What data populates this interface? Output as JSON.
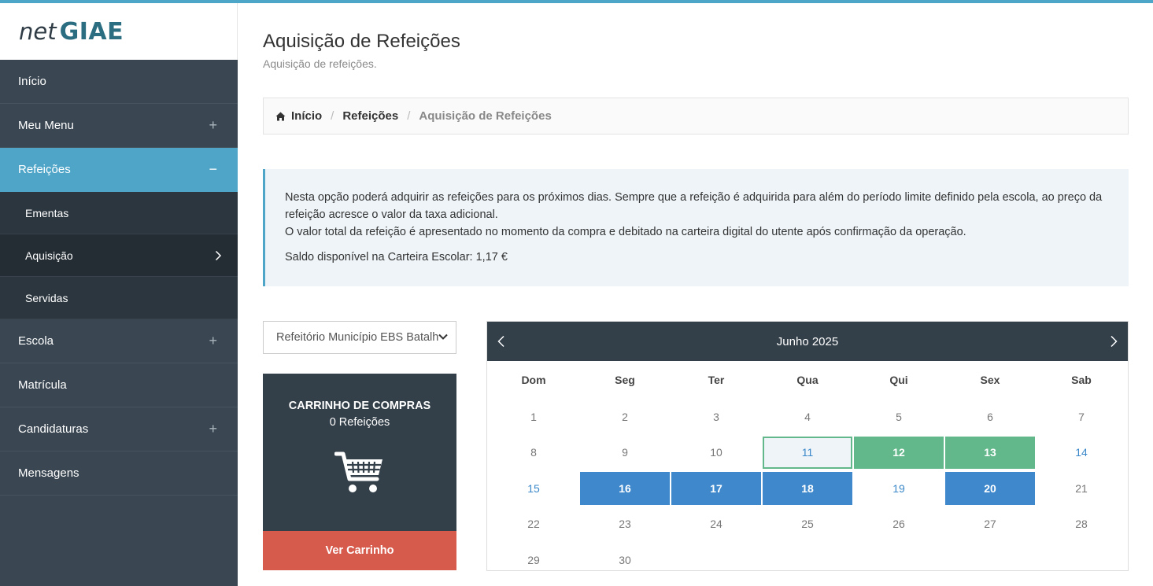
{
  "brand": {
    "net": "net",
    "giae": "GIAE"
  },
  "sidebar": {
    "items": [
      {
        "label": "Início",
        "toggle": ""
      },
      {
        "label": "Meu Menu",
        "toggle": "+"
      },
      {
        "label": "Refeições",
        "toggle": "−"
      },
      {
        "label": "Ementas"
      },
      {
        "label": "Aquisição",
        "chevron": "›"
      },
      {
        "label": "Servidas"
      },
      {
        "label": "Escola",
        "toggle": "+"
      },
      {
        "label": "Matrícula",
        "toggle": ""
      },
      {
        "label": "Candidaturas",
        "toggle": "+"
      },
      {
        "label": "Mensagens",
        "toggle": ""
      }
    ]
  },
  "page": {
    "title": "Aquisição de Refeições",
    "subtitle": "Aquisição de refeições."
  },
  "breadcrumb": {
    "home": "Início",
    "section": "Refeições",
    "current": "Aquisição de Refeições",
    "separator": "/"
  },
  "info": {
    "line1": "Nesta opção poderá adquirir as refeições para os próximos dias. Sempre que a refeição é adquirida para além do período limite definido pela escola, ao preço da refeição acresce o valor da taxa adicional.",
    "line2": "O valor total da refeição é apresentado no momento da compra e debitado na carteira digital do utente após confirmação da operação.",
    "saldo": "Saldo disponível na Carteira Escolar: 1,17 €"
  },
  "canteen_select": {
    "value": "Refeitório Município EBS Batalha"
  },
  "cart": {
    "title": "CARRINHO DE COMPRAS",
    "count": "0 Refeições",
    "button": "Ver Carrinho"
  },
  "calendar": {
    "month": "Junho 2025",
    "weekdays": [
      "Dom",
      "Seg",
      "Ter",
      "Qua",
      "Qui",
      "Sex",
      "Sab"
    ],
    "days": [
      {
        "d": "1",
        "s": "past"
      },
      {
        "d": "2",
        "s": "past"
      },
      {
        "d": "3",
        "s": "past"
      },
      {
        "d": "4",
        "s": "past"
      },
      {
        "d": "5",
        "s": "past"
      },
      {
        "d": "6",
        "s": "past"
      },
      {
        "d": "7",
        "s": "past"
      },
      {
        "d": "8",
        "s": "past"
      },
      {
        "d": "9",
        "s": "past"
      },
      {
        "d": "10",
        "s": "past"
      },
      {
        "d": "11",
        "s": "today"
      },
      {
        "d": "12",
        "s": "green"
      },
      {
        "d": "13",
        "s": "green"
      },
      {
        "d": "14",
        "s": "avail"
      },
      {
        "d": "15",
        "s": "avail"
      },
      {
        "d": "16",
        "s": "blue"
      },
      {
        "d": "17",
        "s": "blue"
      },
      {
        "d": "18",
        "s": "blue"
      },
      {
        "d": "19",
        "s": "avail"
      },
      {
        "d": "20",
        "s": "blue"
      },
      {
        "d": "21",
        "s": "past"
      },
      {
        "d": "22",
        "s": "past"
      },
      {
        "d": "23",
        "s": "past"
      },
      {
        "d": "24",
        "s": "past"
      },
      {
        "d": "25",
        "s": "past"
      },
      {
        "d": "26",
        "s": "past"
      },
      {
        "d": "27",
        "s": "past"
      },
      {
        "d": "28",
        "s": "past"
      },
      {
        "d": "29",
        "s": "past"
      },
      {
        "d": "30",
        "s": "past"
      }
    ]
  },
  "colors": {
    "accent": "#4ea5c8",
    "sidebar": "#3a4753",
    "green": "#62b88a",
    "blue": "#3f88cc",
    "cart_button": "#d75b4c"
  }
}
